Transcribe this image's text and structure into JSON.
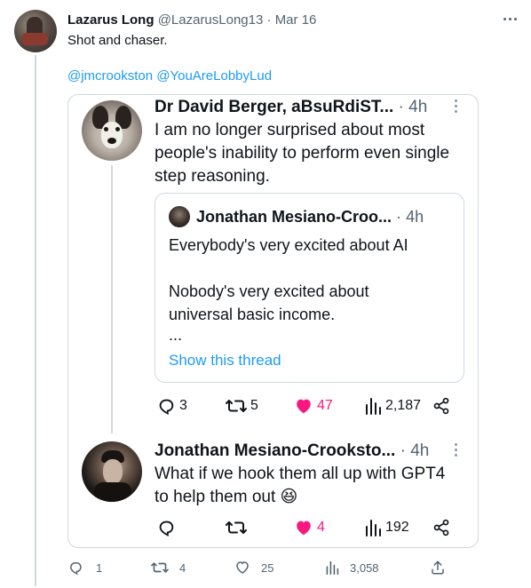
{
  "main_tweet": {
    "author_name": "Lazarus Long",
    "author_handle": "@LazarusLong13",
    "separator": "·",
    "date": "Mar 16",
    "text": "Shot and chaser.",
    "mentions": "@jmcrookston @YouAreLobbyLud",
    "actions": {
      "reply_count": "1",
      "retweet_count": "4",
      "like_count": "25",
      "view_count": "3,058"
    }
  },
  "quoted_tweet": {
    "author_name": "Dr David Berger, aBsuRdiST...",
    "separator": "·",
    "time": "4h",
    "text": "I am no longer surprised about most people's inability to perform even single step reasoning.",
    "nested_quote": {
      "author_name": "Jonathan Mesiano-Croo...",
      "separator": "·",
      "time": "4h",
      "line1": "Everybody's very excited about AI",
      "line2": "Nobody's very excited about universal basic income.",
      "ellipsis": "...",
      "show_thread": "Show this thread"
    },
    "actions": {
      "reply_count": "3",
      "retweet_count": "5",
      "like_count": "47",
      "view_count": "2,187"
    }
  },
  "reply_tweet": {
    "author_name": "Jonathan Mesiano-Crooksto...",
    "separator": "·",
    "time": "4h",
    "text": "What if we hook them all up with GPT4 to help them out 😆",
    "actions": {
      "reply_count": "",
      "retweet_count": "",
      "like_count": "4",
      "view_count": "192"
    }
  },
  "colors": {
    "like_pink": "#f91880",
    "link_blue": "#1d9bf0",
    "muted_gray": "#536471",
    "border": "#cfd9de"
  }
}
